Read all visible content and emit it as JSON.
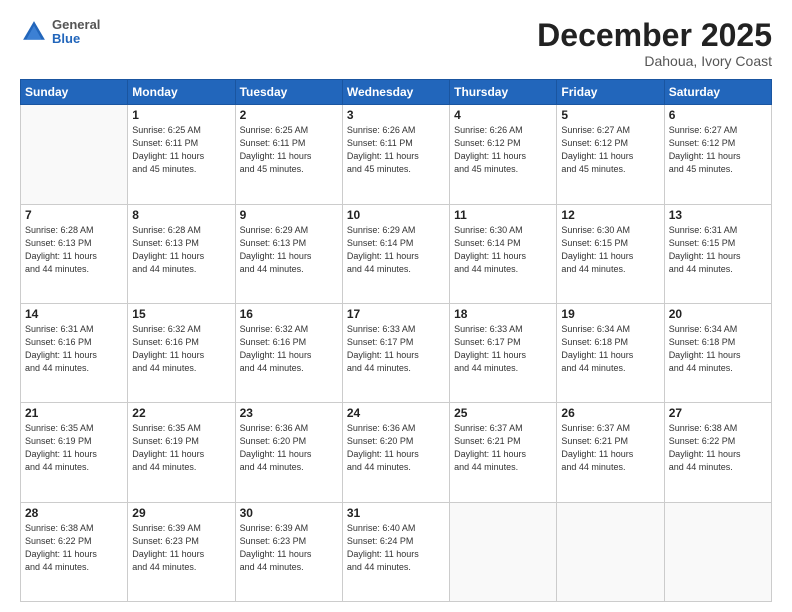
{
  "header": {
    "logo": {
      "general": "General",
      "blue": "Blue"
    },
    "title": "December 2025",
    "location": "Dahoua, Ivory Coast"
  },
  "weekdays": [
    "Sunday",
    "Monday",
    "Tuesday",
    "Wednesday",
    "Thursday",
    "Friday",
    "Saturday"
  ],
  "weeks": [
    [
      {
        "day": "",
        "info": ""
      },
      {
        "day": "1",
        "info": "Sunrise: 6:25 AM\nSunset: 6:11 PM\nDaylight: 11 hours\nand 45 minutes."
      },
      {
        "day": "2",
        "info": "Sunrise: 6:25 AM\nSunset: 6:11 PM\nDaylight: 11 hours\nand 45 minutes."
      },
      {
        "day": "3",
        "info": "Sunrise: 6:26 AM\nSunset: 6:11 PM\nDaylight: 11 hours\nand 45 minutes."
      },
      {
        "day": "4",
        "info": "Sunrise: 6:26 AM\nSunset: 6:12 PM\nDaylight: 11 hours\nand 45 minutes."
      },
      {
        "day": "5",
        "info": "Sunrise: 6:27 AM\nSunset: 6:12 PM\nDaylight: 11 hours\nand 45 minutes."
      },
      {
        "day": "6",
        "info": "Sunrise: 6:27 AM\nSunset: 6:12 PM\nDaylight: 11 hours\nand 45 minutes."
      }
    ],
    [
      {
        "day": "7",
        "info": "Sunrise: 6:28 AM\nSunset: 6:13 PM\nDaylight: 11 hours\nand 44 minutes."
      },
      {
        "day": "8",
        "info": "Sunrise: 6:28 AM\nSunset: 6:13 PM\nDaylight: 11 hours\nand 44 minutes."
      },
      {
        "day": "9",
        "info": "Sunrise: 6:29 AM\nSunset: 6:13 PM\nDaylight: 11 hours\nand 44 minutes."
      },
      {
        "day": "10",
        "info": "Sunrise: 6:29 AM\nSunset: 6:14 PM\nDaylight: 11 hours\nand 44 minutes."
      },
      {
        "day": "11",
        "info": "Sunrise: 6:30 AM\nSunset: 6:14 PM\nDaylight: 11 hours\nand 44 minutes."
      },
      {
        "day": "12",
        "info": "Sunrise: 6:30 AM\nSunset: 6:15 PM\nDaylight: 11 hours\nand 44 minutes."
      },
      {
        "day": "13",
        "info": "Sunrise: 6:31 AM\nSunset: 6:15 PM\nDaylight: 11 hours\nand 44 minutes."
      }
    ],
    [
      {
        "day": "14",
        "info": "Sunrise: 6:31 AM\nSunset: 6:16 PM\nDaylight: 11 hours\nand 44 minutes."
      },
      {
        "day": "15",
        "info": "Sunrise: 6:32 AM\nSunset: 6:16 PM\nDaylight: 11 hours\nand 44 minutes."
      },
      {
        "day": "16",
        "info": "Sunrise: 6:32 AM\nSunset: 6:16 PM\nDaylight: 11 hours\nand 44 minutes."
      },
      {
        "day": "17",
        "info": "Sunrise: 6:33 AM\nSunset: 6:17 PM\nDaylight: 11 hours\nand 44 minutes."
      },
      {
        "day": "18",
        "info": "Sunrise: 6:33 AM\nSunset: 6:17 PM\nDaylight: 11 hours\nand 44 minutes."
      },
      {
        "day": "19",
        "info": "Sunrise: 6:34 AM\nSunset: 6:18 PM\nDaylight: 11 hours\nand 44 minutes."
      },
      {
        "day": "20",
        "info": "Sunrise: 6:34 AM\nSunset: 6:18 PM\nDaylight: 11 hours\nand 44 minutes."
      }
    ],
    [
      {
        "day": "21",
        "info": "Sunrise: 6:35 AM\nSunset: 6:19 PM\nDaylight: 11 hours\nand 44 minutes."
      },
      {
        "day": "22",
        "info": "Sunrise: 6:35 AM\nSunset: 6:19 PM\nDaylight: 11 hours\nand 44 minutes."
      },
      {
        "day": "23",
        "info": "Sunrise: 6:36 AM\nSunset: 6:20 PM\nDaylight: 11 hours\nand 44 minutes."
      },
      {
        "day": "24",
        "info": "Sunrise: 6:36 AM\nSunset: 6:20 PM\nDaylight: 11 hours\nand 44 minutes."
      },
      {
        "day": "25",
        "info": "Sunrise: 6:37 AM\nSunset: 6:21 PM\nDaylight: 11 hours\nand 44 minutes."
      },
      {
        "day": "26",
        "info": "Sunrise: 6:37 AM\nSunset: 6:21 PM\nDaylight: 11 hours\nand 44 minutes."
      },
      {
        "day": "27",
        "info": "Sunrise: 6:38 AM\nSunset: 6:22 PM\nDaylight: 11 hours\nand 44 minutes."
      }
    ],
    [
      {
        "day": "28",
        "info": "Sunrise: 6:38 AM\nSunset: 6:22 PM\nDaylight: 11 hours\nand 44 minutes."
      },
      {
        "day": "29",
        "info": "Sunrise: 6:39 AM\nSunset: 6:23 PM\nDaylight: 11 hours\nand 44 minutes."
      },
      {
        "day": "30",
        "info": "Sunrise: 6:39 AM\nSunset: 6:23 PM\nDaylight: 11 hours\nand 44 minutes."
      },
      {
        "day": "31",
        "info": "Sunrise: 6:40 AM\nSunset: 6:24 PM\nDaylight: 11 hours\nand 44 minutes."
      },
      {
        "day": "",
        "info": ""
      },
      {
        "day": "",
        "info": ""
      },
      {
        "day": "",
        "info": ""
      }
    ]
  ]
}
